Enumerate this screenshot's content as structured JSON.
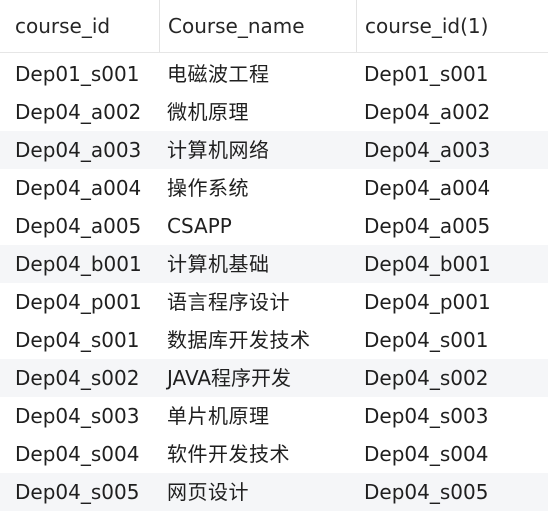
{
  "table": {
    "columns": [
      "course_id",
      "Course_name",
      "course_id(1)"
    ],
    "rows": [
      [
        "Dep01_s001",
        "电磁波工程",
        "Dep01_s001"
      ],
      [
        "Dep04_a002",
        "微机原理",
        "Dep04_a002"
      ],
      [
        "Dep04_a003",
        "计算机网络",
        "Dep04_a003"
      ],
      [
        "Dep04_a004",
        "操作系统",
        "Dep04_a004"
      ],
      [
        "Dep04_a005",
        "CSAPP",
        "Dep04_a005"
      ],
      [
        "Dep04_b001",
        "计算机基础",
        "Dep04_b001"
      ],
      [
        "Dep04_p001",
        "语言程序设计",
        "Dep04_p001"
      ],
      [
        "Dep04_s001",
        "数据库开发技术",
        "Dep04_s001"
      ],
      [
        "Dep04_s002",
        "JAVA程序开发",
        "Dep04_s002"
      ],
      [
        "Dep04_s003",
        "单片机原理",
        "Dep04_s003"
      ],
      [
        "Dep04_s004",
        "软件开发技术",
        "Dep04_s004"
      ],
      [
        "Dep04_s005",
        "网页设计",
        "Dep04_s005"
      ]
    ],
    "alt_rows": [
      2,
      5,
      8,
      11
    ]
  }
}
